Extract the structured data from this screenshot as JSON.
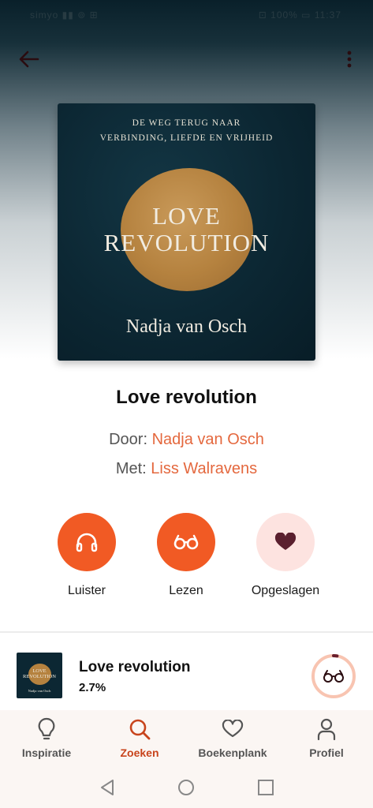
{
  "status_bar": {
    "left": "simyo ▮▮ ⊚ ⊞",
    "right": "⊡ 100% ▭ 11:37"
  },
  "header": {
    "back_icon": "arrow-left-icon",
    "more_icon": "more-vertical-icon"
  },
  "cover": {
    "tagline_line1": "DE WEG TERUG NAAR",
    "tagline_line2": "VERBINDING, LIEFDE EN VRIJHEID",
    "title_line1": "LOVE",
    "title_line2": "REVOLUTION",
    "author": "Nadja van Osch"
  },
  "book": {
    "title": "Love revolution",
    "by_label": "Door:",
    "author": "Nadja van Osch",
    "with_label": "Met:",
    "narrator": "Liss Walravens"
  },
  "actions": [
    {
      "label": "Luister",
      "icon": "headphones-icon"
    },
    {
      "label": "Lezen",
      "icon": "glasses-icon"
    },
    {
      "label": "Opgeslagen",
      "icon": "heart-icon"
    }
  ],
  "mini_player": {
    "cover_title_line1": "LOVE",
    "cover_title_line2": "REVOLUTION",
    "cover_author": "Nadja van Osch",
    "title": "Love revolution",
    "progress": "2.7%",
    "progress_fraction": 0.027,
    "icon": "glasses-icon"
  },
  "bottom_nav": [
    {
      "label": "Inspiratie",
      "icon": "lightbulb-icon",
      "active": false
    },
    {
      "label": "Zoeken",
      "icon": "search-icon",
      "active": true
    },
    {
      "label": "Boekenplank",
      "icon": "heart-icon",
      "active": false
    },
    {
      "label": "Profiel",
      "icon": "person-icon",
      "active": false
    }
  ],
  "colors": {
    "accent": "#f15a24",
    "accent_text": "#e4683e",
    "active_nav": "#c8441c",
    "saved_bg": "#fde3e0",
    "saved_heart": "#5a1f2e"
  }
}
